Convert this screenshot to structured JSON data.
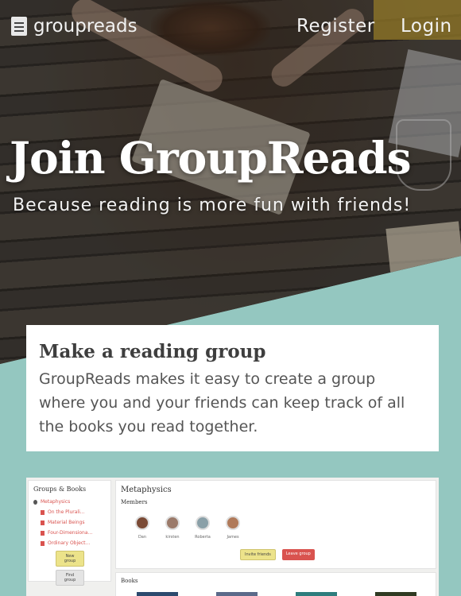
{
  "nav": {
    "brand": "groupreads",
    "register": "Register",
    "login": "Login"
  },
  "hero": {
    "title": "Join GroupReads",
    "subtitle": "Because reading is more fun with friends!"
  },
  "feature": {
    "title": "Make a reading group",
    "text": "GroupReads makes it easy to create a group where you and your friends can keep track of all the books you read together."
  },
  "preview": {
    "sidebar_heading": "Groups & Books",
    "groups": [
      "Metaphysics"
    ],
    "books": [
      "On the Plurali...",
      "Material Beings",
      "Four-Dimensiona...",
      "Ordinary Object..."
    ],
    "new_group": "New group",
    "find_group": "Find group",
    "group_title": "Metaphysics",
    "members_heading": "Members",
    "members": [
      {
        "name": "Dan",
        "color": "#7a4a35"
      },
      {
        "name": "kirsten",
        "color": "#9b7a6a"
      },
      {
        "name": "Roberta",
        "color": "#8aa0a8"
      },
      {
        "name": "James",
        "color": "#b07a5a"
      }
    ],
    "invite_friends": "Invite friends",
    "leave_group": "Leave group",
    "books_heading": "Books",
    "cover_colors": [
      "#2c4a6e",
      "#5b6a8a",
      "#2e7d7d",
      "#2f3a22"
    ]
  },
  "colors": {
    "teal_background": "#94c7c0",
    "accent_red": "#d9534f",
    "accent_yellow": "#ece38a"
  }
}
